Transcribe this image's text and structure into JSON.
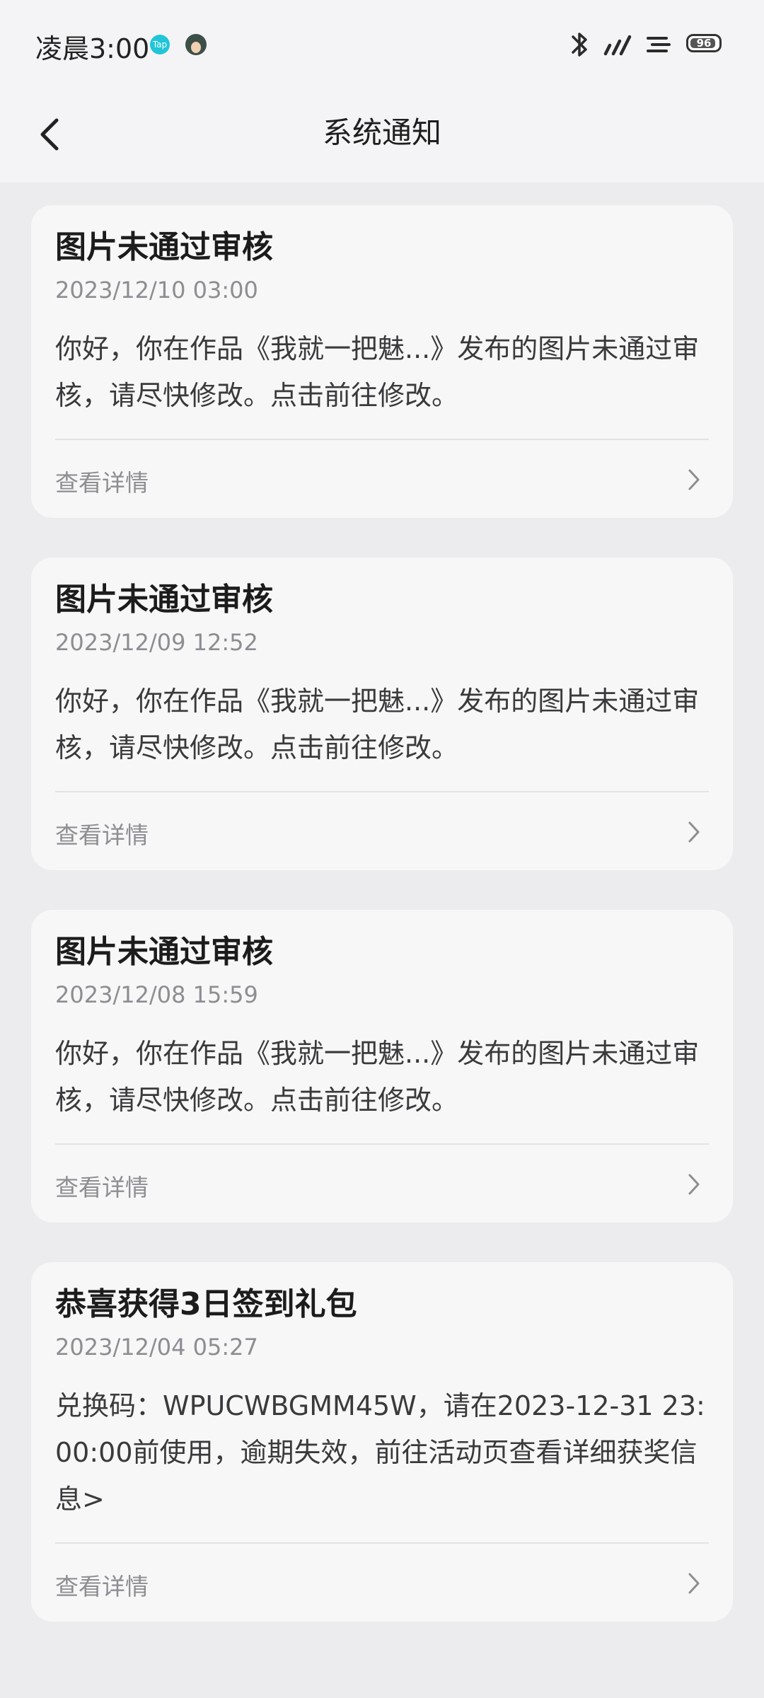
{
  "status_bar": {
    "time": "凌晨3:00",
    "app_badge": "Tap",
    "battery": "96"
  },
  "nav": {
    "title": "系统通知",
    "back_icon": "chevron-left-icon"
  },
  "notifications": [
    {
      "title": "图片未通过审核",
      "time": "2023/12/10 03:00",
      "body": "你好，你在作品《我就一把魅...》发布的图片未通过审核，请尽快修改。点击前往修改。",
      "link": "查看详情"
    },
    {
      "title": "图片未通过审核",
      "time": "2023/12/09 12:52",
      "body": "你好，你在作品《我就一把魅...》发布的图片未通过审核，请尽快修改。点击前往修改。",
      "link": "查看详情"
    },
    {
      "title": "图片未通过审核",
      "time": "2023/12/08 15:59",
      "body": "你好，你在作品《我就一把魅...》发布的图片未通过审核，请尽快修改。点击前往修改。",
      "link": "查看详情"
    },
    {
      "title": "恭喜获得3日签到礼包",
      "time": "2023/12/04 05:27",
      "body": "兑换码：WPUCWBGMM45W，请在2023-12-31 23:00:00前使用，逾期失效，前往活动页查看详细获奖信息>",
      "link": "查看详情"
    }
  ],
  "colors": {
    "background": "#ececee",
    "card": "#f7f7f8",
    "secondary_text": "#8d8d92"
  }
}
